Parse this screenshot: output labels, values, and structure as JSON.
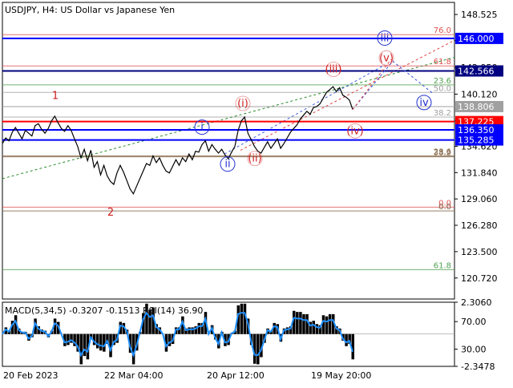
{
  "header": {
    "title": "USDJPY, H4:  US Dollar vs Japanese Yen"
  },
  "macd_panel": {
    "label": "MACD(5,34,5) -0.3207 -0.1513 RSI(14) 36.90",
    "axis_ticks": [
      "2.3060",
      "70.00",
      "30.00",
      "-2.3478"
    ]
  },
  "colors": {
    "background": "#ffffff",
    "grid": "#c0c0c0",
    "axis": "#000000",
    "price_line": "#000000",
    "horizontal_blue": "#0000ff",
    "horizontal_red": "#ff0000",
    "horizontal_navy": "#000080",
    "fib_line": "#008000",
    "wave_red": "#d02020",
    "wave_blue": "#2030d0",
    "macd_hist": "#000000",
    "rsi_line": "#1e90ff"
  },
  "chart_data": {
    "type": "line",
    "symbol": "USDJPY",
    "timeframe": "H4",
    "ylim": [
      118.5,
      149.8
    ],
    "y_ticks": [
      "148.525",
      "145.780",
      "142.950",
      "140.120",
      "137.290",
      "134.620",
      "131.840",
      "129.060",
      "126.280",
      "123.500",
      "120.720"
    ],
    "x_ticks": [
      "20 Feb 2023",
      "22 Mar 04:00",
      "20 Apr 12:00",
      "19 May 20:00"
    ],
    "series": [
      {
        "values": [
          134.9,
          135.5,
          135.2,
          136.1,
          136.6,
          136.0,
          135.4,
          136.3,
          136.0,
          135.7,
          136.8,
          137.0,
          136.4,
          136.0,
          136.5,
          137.3,
          137.8,
          137.1,
          136.5,
          136.2,
          136.8,
          136.3,
          135.4,
          134.6,
          133.4,
          134.3,
          133.1,
          134.2,
          132.4,
          133.0,
          131.6,
          132.6,
          131.5,
          130.9,
          130.6,
          131.8,
          132.6,
          131.9,
          131.0,
          130.1,
          129.6,
          130.4,
          131.2,
          132.0,
          132.8,
          132.6,
          133.6,
          132.9,
          133.4,
          132.6,
          132.0,
          131.8,
          132.5,
          133.2,
          132.6,
          133.4,
          133.0,
          133.8,
          133.2,
          134.1,
          134.0,
          134.8,
          135.2,
          134.1,
          134.8,
          134.3,
          133.9,
          134.3,
          133.7,
          133.3,
          134.0,
          134.6,
          136.3,
          137.3,
          137.7,
          136.0,
          135.3,
          134.6,
          134.1,
          133.9,
          134.5,
          135.1,
          134.4,
          134.9,
          135.4,
          134.4,
          134.9,
          135.5,
          136.1,
          136.5,
          136.9,
          137.5,
          137.9,
          138.3,
          138.0,
          138.7,
          138.8,
          139.1,
          139.7,
          140.3,
          140.6,
          140.9,
          140.4,
          140.8,
          140.0,
          139.8,
          139.5,
          138.5
        ]
      }
    ],
    "horizontal_lines": [
      {
        "price": 146.0,
        "label": "146.000",
        "color": "#0000ff",
        "style": "solid"
      },
      {
        "price": 142.566,
        "label": "142.566",
        "color": "#000080",
        "style": "solid"
      },
      {
        "price": 138.806,
        "label": "138.806",
        "color": "#a0a0a0",
        "style": "solid"
      },
      {
        "price": 137.225,
        "label": "137.225",
        "color": "#ff0000",
        "style": "solid"
      },
      {
        "price": 136.35,
        "label": "136.350",
        "color": "#0000ff",
        "style": "solid"
      },
      {
        "price": 135.285,
        "label": "135.285",
        "color": "#0000ff",
        "style": "solid"
      }
    ],
    "fib_levels": [
      {
        "price": 146.4,
        "label": "76.0",
        "color": "#e05050"
      },
      {
        "price": 143.1,
        "label": "61.8",
        "color": "#e05050"
      },
      {
        "price": 141.1,
        "label": "23.6",
        "color": "#50a050"
      },
      {
        "price": 140.3,
        "label": "50.0",
        "color": "#a0a0a0"
      },
      {
        "price": 137.7,
        "label": "38.2",
        "color": "#a0a0a0"
      },
      {
        "price": 133.6,
        "label": "23.6",
        "color": "#806040"
      },
      {
        "price": 133.5,
        "label": "38.2",
        "color": "#806040"
      },
      {
        "price": 128.2,
        "label": "0.0",
        "color": "#e05050"
      },
      {
        "price": 127.8,
        "label": "0.0",
        "color": "#806040"
      },
      {
        "price": 121.6,
        "label": "61.8",
        "color": "#50a050"
      }
    ],
    "wave_labels": [
      {
        "text": "1",
        "color": "#d02020"
      },
      {
        "text": "2",
        "color": "#d02020"
      },
      {
        "text": "i",
        "color": "#2030d0"
      },
      {
        "text": "ii",
        "color": "#2030d0"
      },
      {
        "text": "(i)",
        "color": "#d02020"
      },
      {
        "text": "(ii)",
        "color": "#d02020"
      },
      {
        "text": "(iii)",
        "color": "#d02020"
      },
      {
        "text": "(iv)",
        "color": "#d02020"
      },
      {
        "text": "(v)",
        "color": "#d02020"
      },
      {
        "text": "iii",
        "color": "#2030d0"
      },
      {
        "text": "iv",
        "color": "#2030d0"
      }
    ]
  }
}
